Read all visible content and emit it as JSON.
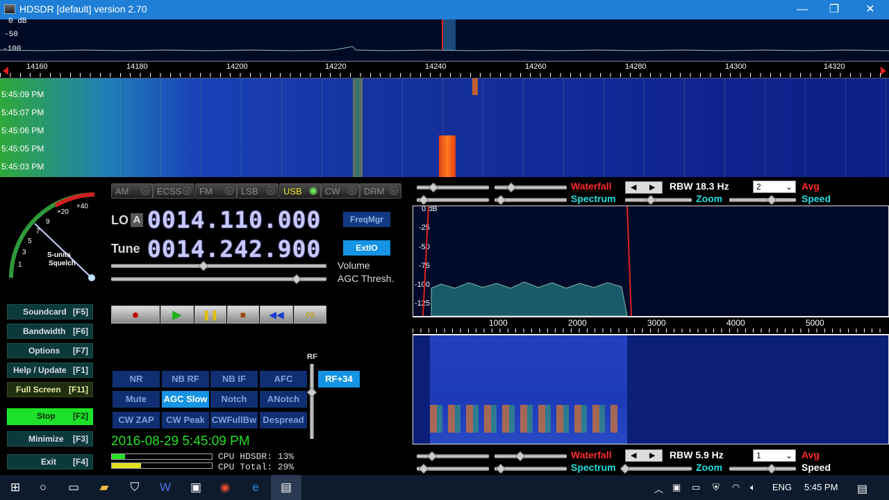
{
  "window": {
    "title": "HDSDR [default]  version 2.70",
    "minimize": "—",
    "maximize": "❐",
    "close": "✕"
  },
  "top_spectrum": {
    "db_labels": [
      "0 dB",
      "-50",
      "-100"
    ]
  },
  "freq_scale": {
    "ticks": [
      "14160",
      "14180",
      "14200",
      "14220",
      "14240",
      "14260",
      "14280",
      "14300",
      "14320"
    ]
  },
  "waterfall": {
    "timestamps": [
      "5:45:09 PM",
      "5:45:07 PM",
      "5:45:06 PM",
      "5:45:05 PM",
      "5:45:03 PM"
    ]
  },
  "smeter": {
    "scale_labels": [
      "1",
      "3",
      "5",
      "7",
      "9",
      "+20",
      "+40"
    ],
    "label1": "S-units",
    "label2": "Squelch"
  },
  "modes": [
    {
      "label": "AM",
      "active": false
    },
    {
      "label": "ECSS",
      "active": false
    },
    {
      "label": "FM",
      "active": false
    },
    {
      "label": "LSB",
      "active": false
    },
    {
      "label": "USB",
      "active": true
    },
    {
      "label": "CW",
      "active": false
    },
    {
      "label": "DRM",
      "active": false
    }
  ],
  "lo": {
    "label": "LO",
    "badge": "A",
    "value": "0014.110.000"
  },
  "tune": {
    "label": "Tune",
    "value": "0014.242.900"
  },
  "buttons": {
    "freqmgr": "FreqMgr",
    "extio": "ExtIO"
  },
  "sliders": {
    "volume_label": "Volume",
    "agc_label": "AGC Thresh.",
    "volume": 0.43,
    "agc": 0.86
  },
  "side_buttons": [
    {
      "label": "Soundcard",
      "key": "[F5]"
    },
    {
      "label": "Bandwidth",
      "key": "[F6]"
    },
    {
      "label": "Options",
      "key": "[F7]"
    },
    {
      "label": "Help / Update",
      "key": "[F1]"
    },
    {
      "label": "Full Screen",
      "key": "[F11]"
    },
    {
      "label": "Stop",
      "key": "[F2]"
    },
    {
      "label": "Minimize",
      "key": "[F3]"
    },
    {
      "label": "Exit",
      "key": "[F4]"
    }
  ],
  "transport": {
    "record": "●",
    "play": "▶",
    "pause": "❚❚",
    "stop": "■",
    "rewind": "◀◀",
    "loop": "∞"
  },
  "dsp": {
    "row1": [
      "NR",
      "NB RF",
      "NB IF",
      "AFC"
    ],
    "row2": [
      "Mute",
      "AGC Slow",
      "Notch",
      "ANotch"
    ],
    "row3": [
      "CW ZAP",
      "CW Peak",
      "CWFullBw",
      "Despread"
    ],
    "rf_label": "RF",
    "rf_value": "RF+34"
  },
  "status": {
    "datetime": "2016-08-29 5:45:09 PM",
    "cpu_hdsdr": "CPU HDSDR: 13%",
    "cpu_total": "CPU Total: 29%",
    "cpu_hdsdr_frac": 0.13,
    "cpu_total_frac": 0.29
  },
  "top_controls": {
    "waterfall": "Waterfall",
    "spectrum": "Spectrum",
    "rbw": "RBW 18.3 Hz",
    "zoom": "Zoom",
    "avg_value": "2",
    "avg": "Avg",
    "speed": "Speed"
  },
  "audio_spectrum": {
    "db_labels": [
      "0 dB",
      "-25",
      "-50",
      "-75",
      "-100",
      "-125"
    ]
  },
  "audio_scale": {
    "ticks": [
      "1000",
      "2000",
      "3000",
      "4000",
      "5000"
    ]
  },
  "bottom_controls": {
    "waterfall": "Waterfall",
    "spectrum": "Spectrum",
    "rbw": "RBW  5.9 Hz",
    "zoom": "Zoom",
    "avg_value": "1",
    "avg": "Avg",
    "speed": "Speed"
  },
  "taskbar": {
    "lang": "ENG",
    "time": "5:45 PM"
  },
  "colors": {
    "accent": "#1593e4",
    "waterfall_label": "#ff2a2a",
    "spectrum_label": "#22e0e0",
    "avg_label": "#ff2a2a"
  }
}
